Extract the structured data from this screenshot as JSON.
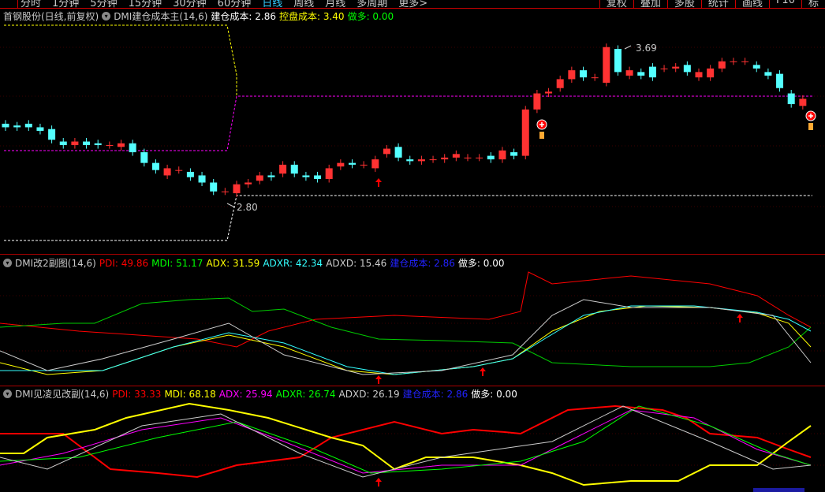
{
  "toolbar": {
    "periods": [
      "分时",
      "1分钟",
      "5分钟",
      "15分钟",
      "30分钟",
      "60分钟",
      "日线",
      "周线",
      "月线",
      "多周期",
      "更多>"
    ],
    "active": "日线",
    "tools": [
      "复权",
      "叠加",
      "多股",
      "统计",
      "画线",
      "F10",
      "标"
    ]
  },
  "main": {
    "stock": "首钢股份(日线,前复权)",
    "indicator": "DMI建仓成本主(14,6)",
    "cost_label": "建仓成本: 2.86",
    "control_label": "控盘成本: 3.40",
    "long_label": "做多: 0.00",
    "high_mark": "3.69",
    "low_mark": "2.80"
  },
  "panel2": {
    "name": "DMI改2副图(14,6)",
    "pdi": "PDI: 49.86",
    "mdi": "MDI: 51.17",
    "adx": "ADX: 31.59",
    "adxr": "ADXR: 42.34",
    "adxd": "ADXD: 15.46",
    "cost": "建仓成本: 2.86",
    "long": "做多: 0.00"
  },
  "panel3": {
    "name": "DMI见凌见改副(14,6)",
    "pdi": "PDI: 33.33",
    "mdi": "MDI: 68.18",
    "adx": "ADX: 25.94",
    "adxr": "ADXR: 26.74",
    "adxd": "ADXD: 26.19",
    "cost": "建仓成本: 2.86",
    "long": "做多: 0.00"
  },
  "colors": {
    "up": "#ff3232",
    "down": "#54ffff",
    "accent": "#33ccff"
  },
  "candles": [
    [
      3.27,
      3.25
    ],
    [
      3.26,
      3.25
    ],
    [
      3.27,
      3.25
    ],
    [
      3.25,
      3.23
    ],
    [
      3.24,
      3.18
    ],
    [
      3.17,
      3.15
    ],
    [
      3.15,
      3.17
    ],
    [
      3.17,
      3.15
    ],
    [
      3.16,
      3.15
    ],
    [
      3.15,
      3.15
    ],
    [
      3.14,
      3.16
    ],
    [
      3.16,
      3.11
    ],
    [
      3.11,
      3.05
    ],
    [
      3.05,
      3.01
    ],
    [
      2.98,
      3.02
    ],
    [
      3.01,
      3.01
    ],
    [
      3.0,
      2.97
    ],
    [
      2.98,
      2.94
    ],
    [
      2.94,
      2.89
    ],
    [
      2.89,
      2.89
    ],
    [
      2.88,
      2.93
    ],
    [
      2.93,
      2.94
    ],
    [
      2.95,
      2.98
    ],
    [
      2.98,
      2.97
    ],
    [
      2.99,
      3.04
    ],
    [
      3.04,
      2.99
    ],
    [
      2.98,
      2.97
    ],
    [
      2.98,
      2.96
    ],
    [
      2.96,
      3.02
    ],
    [
      3.03,
      3.05
    ],
    [
      3.05,
      3.04
    ],
    [
      3.04,
      3.04
    ],
    [
      3.02,
      3.07
    ],
    [
      3.1,
      3.13
    ],
    [
      3.14,
      3.08
    ],
    [
      3.07,
      3.06
    ],
    [
      3.06,
      3.07
    ],
    [
      3.07,
      3.07
    ],
    [
      3.07,
      3.08
    ],
    [
      3.08,
      3.1
    ],
    [
      3.08,
      3.08
    ],
    [
      3.08,
      3.08
    ],
    [
      3.09,
      3.07
    ],
    [
      3.07,
      3.12
    ],
    [
      3.11,
      3.09
    ],
    [
      3.09,
      3.35
    ],
    [
      3.35,
      3.44
    ],
    [
      3.44,
      3.45
    ],
    [
      3.47,
      3.52
    ],
    [
      3.52,
      3.57
    ],
    [
      3.57,
      3.53
    ],
    [
      3.53,
      3.53
    ],
    [
      3.5,
      3.7
    ],
    [
      3.69,
      3.56
    ],
    [
      3.54,
      3.57
    ],
    [
      3.56,
      3.54
    ],
    [
      3.59,
      3.53
    ],
    [
      3.58,
      3.58
    ],
    [
      3.58,
      3.59
    ],
    [
      3.6,
      3.56
    ],
    [
      3.53,
      3.56
    ],
    [
      3.53,
      3.58
    ],
    [
      3.58,
      3.62
    ],
    [
      3.62,
      3.62
    ],
    [
      3.62,
      3.62
    ],
    [
      3.6,
      3.58
    ],
    [
      3.56,
      3.54
    ],
    [
      3.55,
      3.47
    ],
    [
      3.44,
      3.38
    ],
    [
      3.37,
      3.41
    ]
  ]
}
